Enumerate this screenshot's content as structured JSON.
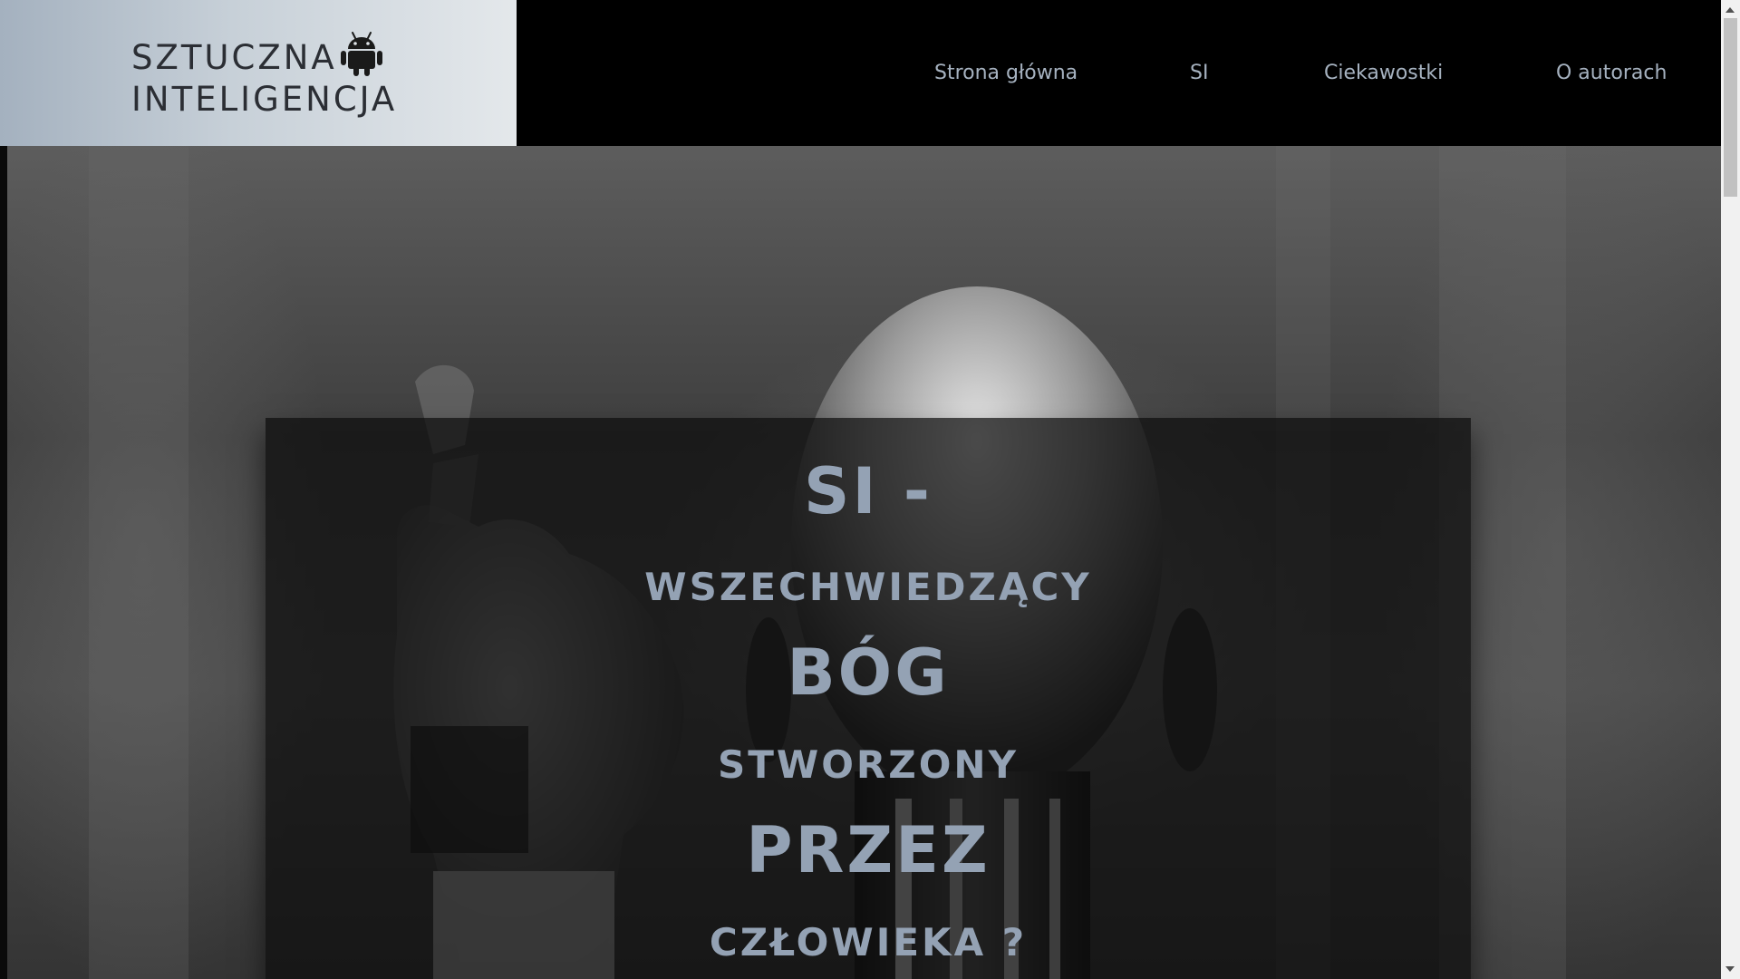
{
  "header": {
    "logo": {
      "line1": "SZTUCZNA",
      "line2": "INTELIGENCJA",
      "icon": "android-icon"
    },
    "nav": [
      {
        "label": "Strona główna"
      },
      {
        "label": "SI"
      },
      {
        "label": "Ciekawostki"
      },
      {
        "label": "O autorach"
      }
    ]
  },
  "hero": {
    "lines": [
      "SI -",
      "WSZECHWIEDZĄCY",
      "BÓG",
      "STWORZONY",
      "PRZEZ",
      "CZŁOWIEKA ?"
    ],
    "background": "robot-face-image"
  },
  "colors": {
    "header_bg": "#000000",
    "logo_gradient_start": "#a4b1bf",
    "logo_gradient_end": "#e4e8eb",
    "logo_text": "#2b2e34",
    "nav_text": "#a6b2c0",
    "hero_text": "#94a2b4",
    "overlay": "rgba(12,12,12,0.72)"
  },
  "scrollbar": {
    "icons": [
      "scroll-up-arrow-icon",
      "scroll-down-arrow-icon"
    ]
  }
}
